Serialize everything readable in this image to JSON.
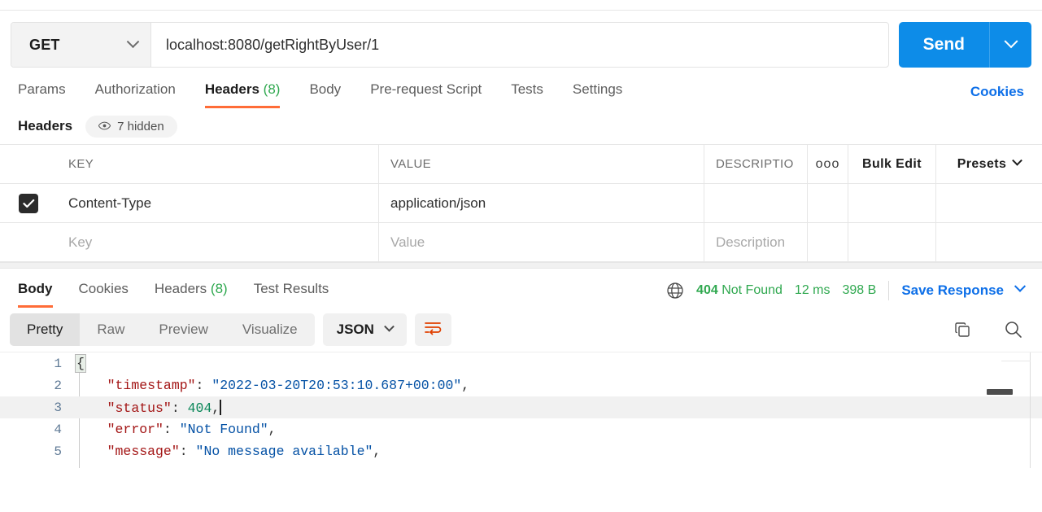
{
  "request": {
    "method": "GET",
    "method_caret_icon": "chevron-down-icon",
    "url_value": "localhost:8080/getRightByUser/1",
    "url_placeholder": "Enter request URL",
    "send_label": "Send",
    "send_caret_icon": "chevron-down-icon"
  },
  "request_tabs": {
    "items": [
      {
        "label": "Params",
        "count": "",
        "active": false
      },
      {
        "label": "Authorization",
        "count": "",
        "active": false
      },
      {
        "label": "Headers",
        "count": "(8)",
        "active": true
      },
      {
        "label": "Body",
        "count": "",
        "active": false
      },
      {
        "label": "Pre-request Script",
        "count": "",
        "active": false
      },
      {
        "label": "Tests",
        "count": "",
        "active": false
      },
      {
        "label": "Settings",
        "count": "",
        "active": false
      }
    ],
    "cookies_link": "Cookies"
  },
  "headers_section": {
    "title": "Headers",
    "hidden_badge": {
      "icon": "eye-icon",
      "label": "7 hidden"
    },
    "columns": {
      "key": "KEY",
      "value": "VALUE",
      "description": "DESCRIPTIO",
      "more_icon": "ooo",
      "bulk_edit": "Bulk Edit",
      "presets": "Presets",
      "presets_caret_icon": "chevron-down-icon"
    },
    "rows": [
      {
        "checked": true,
        "key": "Content-Type",
        "value": "application/json",
        "description": ""
      }
    ],
    "new_row_placeholders": {
      "key": "Key",
      "value": "Value",
      "description": "Description"
    }
  },
  "response": {
    "tabs": [
      {
        "label": "Body",
        "count": "",
        "active": true
      },
      {
        "label": "Cookies",
        "count": "",
        "active": false
      },
      {
        "label": "Headers",
        "count": "(8)",
        "active": false
      },
      {
        "label": "Test Results",
        "count": "",
        "active": false
      }
    ],
    "globe_icon": "globe-icon",
    "status_code": "404",
    "status_text": "Not Found",
    "time": "12 ms",
    "size": "398 B",
    "save_label": "Save Response",
    "save_caret_icon": "chevron-down-icon",
    "status_color": "#2fa84f",
    "link_color": "#0d6fe8"
  },
  "viewer_toolbar": {
    "modes": [
      {
        "label": "Pretty",
        "active": true
      },
      {
        "label": "Raw",
        "active": false
      },
      {
        "label": "Preview",
        "active": false
      },
      {
        "label": "Visualize",
        "active": false
      }
    ],
    "format": "JSON",
    "format_caret_icon": "chevron-down-icon",
    "wrap_icon": "word-wrap-icon",
    "copy_icon": "copy-icon",
    "search_icon": "search-icon",
    "accent_color": "#ff6c37"
  },
  "code_viewer": {
    "language": "json",
    "active_line": 3,
    "lines": [
      {
        "num": "1",
        "tokens": [
          {
            "t": "{",
            "c": "brace"
          }
        ]
      },
      {
        "num": "2",
        "tokens": [
          {
            "t": "    ",
            "c": "punc"
          },
          {
            "t": "\"timestamp\"",
            "c": "key"
          },
          {
            "t": ": ",
            "c": "punc"
          },
          {
            "t": "\"2022-03-20T20:53:10.687+00:00\"",
            "c": "str"
          },
          {
            "t": ",",
            "c": "punc"
          }
        ]
      },
      {
        "num": "3",
        "tokens": [
          {
            "t": "    ",
            "c": "punc"
          },
          {
            "t": "\"status\"",
            "c": "key"
          },
          {
            "t": ": ",
            "c": "punc"
          },
          {
            "t": "404",
            "c": "num"
          },
          {
            "t": ",",
            "c": "punc"
          }
        ]
      },
      {
        "num": "4",
        "tokens": [
          {
            "t": "    ",
            "c": "punc"
          },
          {
            "t": "\"error\"",
            "c": "key"
          },
          {
            "t": ": ",
            "c": "punc"
          },
          {
            "t": "\"Not Found\"",
            "c": "str"
          },
          {
            "t": ",",
            "c": "punc"
          }
        ]
      },
      {
        "num": "5",
        "tokens": [
          {
            "t": "    ",
            "c": "punc"
          },
          {
            "t": "\"message\"",
            "c": "key"
          },
          {
            "t": ": ",
            "c": "punc"
          },
          {
            "t": "\"No message available\"",
            "c": "str"
          },
          {
            "t": ",",
            "c": "punc"
          }
        ]
      }
    ]
  }
}
